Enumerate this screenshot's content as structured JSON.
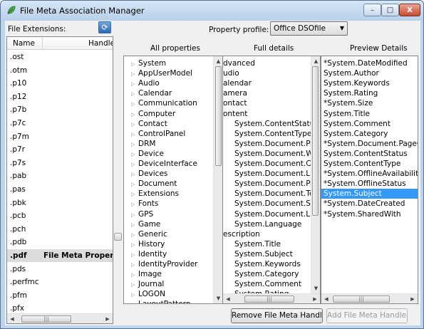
{
  "window": {
    "title": "File Meta Association Manager",
    "buttons": {
      "minimize": "–",
      "maximize": "□",
      "close": "X"
    }
  },
  "toolbar": {
    "extensions_label": "File Extensions:",
    "refresh_icon": "refresh-icon",
    "profile_label": "Property profile:",
    "profile_value": "Office DSOfile"
  },
  "extensions": {
    "columns": [
      "Name",
      "Handle"
    ],
    "rows": [
      {
        "name": ".ost",
        "handler": ""
      },
      {
        "name": ".otm",
        "handler": ""
      },
      {
        "name": ".p10",
        "handler": ""
      },
      {
        "name": ".p12",
        "handler": ""
      },
      {
        "name": ".p7b",
        "handler": ""
      },
      {
        "name": ".p7c",
        "handler": ""
      },
      {
        "name": ".p7m",
        "handler": ""
      },
      {
        "name": ".p7r",
        "handler": ""
      },
      {
        "name": ".p7s",
        "handler": ""
      },
      {
        "name": ".pab",
        "handler": ""
      },
      {
        "name": ".pas",
        "handler": ""
      },
      {
        "name": ".pbk",
        "handler": ""
      },
      {
        "name": ".pcb",
        "handler": ""
      },
      {
        "name": ".pch",
        "handler": ""
      },
      {
        "name": ".pdb",
        "handler": ""
      },
      {
        "name": ".pdf",
        "handler": "File Meta Property",
        "selected": true
      },
      {
        "name": ".pds",
        "handler": ""
      },
      {
        "name": ".perfmc",
        "handler": ""
      },
      {
        "name": ".pfm",
        "handler": ""
      },
      {
        "name": ".pfx",
        "handler": ""
      }
    ]
  },
  "all_properties": {
    "header": "All properties",
    "items": [
      "System",
      "AppUserModel",
      "Audio",
      "Calendar",
      "Communication",
      "Computer",
      "Contact",
      "ControlPanel",
      "DRM",
      "Device",
      "DeviceInterface",
      "Devices",
      "Document",
      "Extensions",
      "Fonts",
      "GPS",
      "Game",
      "Generic",
      "History",
      "Identity",
      "IdentityProvider",
      "Image",
      "Journal",
      "LOGON",
      "LayoutPattern"
    ]
  },
  "full_details": {
    "header": "Full details",
    "items": [
      {
        "text": "dvanced",
        "indent": 0
      },
      {
        "text": "udio",
        "indent": 0
      },
      {
        "text": "alendar",
        "indent": 0
      },
      {
        "text": "amera",
        "indent": 0
      },
      {
        "text": "ontact",
        "indent": 0
      },
      {
        "text": "ontent",
        "indent": 0
      },
      {
        "text": "System.ContentStatus",
        "indent": 1
      },
      {
        "text": "System.ContentType",
        "indent": 1
      },
      {
        "text": "System.Document.PageCount",
        "indent": 1
      },
      {
        "text": "System.Document.WordCount",
        "indent": 1
      },
      {
        "text": "System.Document.CharacterCount",
        "indent": 1
      },
      {
        "text": "System.Document.LineCount",
        "indent": 1
      },
      {
        "text": "System.Document.ParagraphCount",
        "indent": 1
      },
      {
        "text": "System.Document.Template",
        "indent": 1
      },
      {
        "text": "System.Document.Scale",
        "indent": 1
      },
      {
        "text": "System.Document.LinksDirty",
        "indent": 1
      },
      {
        "text": "System.Language",
        "indent": 1
      },
      {
        "text": "escription",
        "indent": 0
      },
      {
        "text": "System.Title",
        "indent": 1
      },
      {
        "text": "System.Subject",
        "indent": 1
      },
      {
        "text": "System.Keywords",
        "indent": 1
      },
      {
        "text": "System.Category",
        "indent": 1
      },
      {
        "text": "System.Comment",
        "indent": 1
      },
      {
        "text": "System.Rating",
        "indent": 1
      }
    ]
  },
  "preview_details": {
    "header": "Preview Details",
    "items": [
      {
        "text": "*System.DateModified"
      },
      {
        "text": "System.Author"
      },
      {
        "text": "System.Keywords"
      },
      {
        "text": "System.Rating"
      },
      {
        "text": "*System.Size"
      },
      {
        "text": "System.Title"
      },
      {
        "text": "System.Comment"
      },
      {
        "text": "System.Category"
      },
      {
        "text": "*System.Document.PageCount"
      },
      {
        "text": "System.ContentStatus"
      },
      {
        "text": "System.ContentType"
      },
      {
        "text": "*System.OfflineAvailability"
      },
      {
        "text": "*System.OfflineStatus"
      },
      {
        "text": "System.Subject",
        "selected": true
      },
      {
        "text": "*System.DateCreated"
      },
      {
        "text": "*System.SharedWith"
      }
    ]
  },
  "actions": {
    "remove_label": "Remove File Meta Handler",
    "add_label": "Add File Meta Handler"
  },
  "colors": {
    "selection": "#3399ff",
    "title_text": "#000000"
  }
}
